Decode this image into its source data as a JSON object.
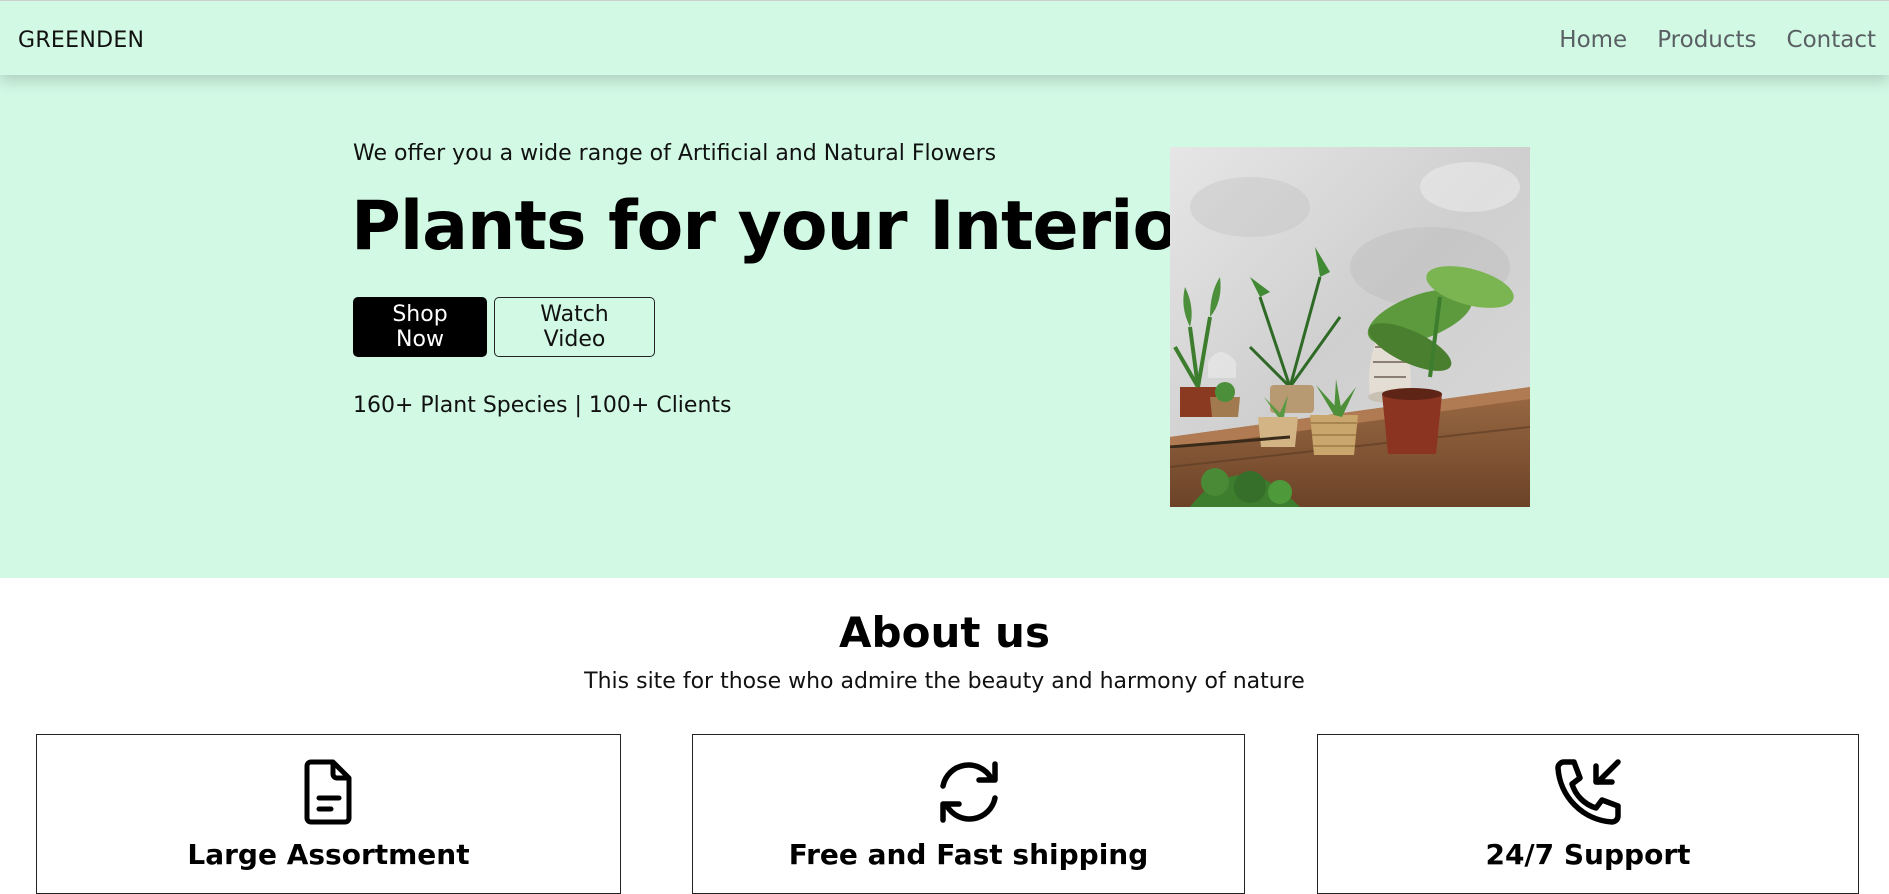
{
  "nav": {
    "brand": "GREENDEN",
    "links": [
      "Home",
      "Products",
      "Contact"
    ]
  },
  "hero": {
    "subtitle": "We offer you a wide range of Artificial and Natural Flowers",
    "title": "Plants for your Interior",
    "primary_button": "Shop Now",
    "secondary_button": "Watch Video",
    "stats": "160+ Plant Species | 100+ Clients",
    "image_icon": "potted-plants-photo"
  },
  "about": {
    "title": "About us",
    "subtitle": "This site for those who admire the beauty and harmony of nature"
  },
  "features": [
    {
      "title": "Large Assortment",
      "icon": "document-icon"
    },
    {
      "title": "Free and Fast shipping",
      "icon": "refresh-icon"
    },
    {
      "title": "24/7 Support",
      "icon": "phone-incoming-icon"
    }
  ],
  "colors": {
    "mint": "#d1f9e4",
    "primary_button": "#000000",
    "nav_link": "#5a5f63"
  }
}
